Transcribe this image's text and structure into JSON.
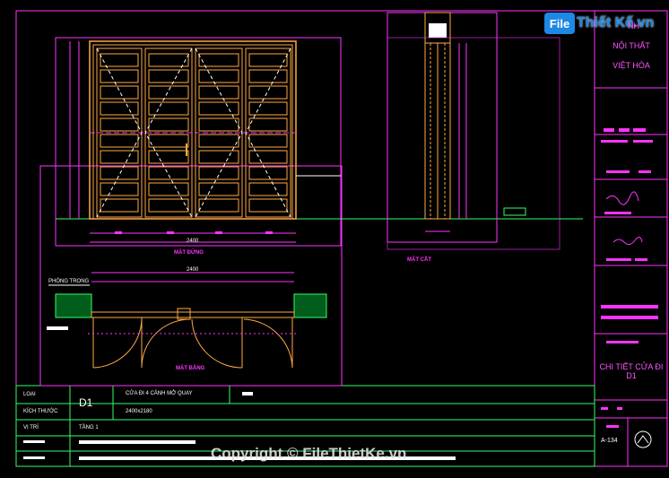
{
  "watermark": {
    "logo_prefix": "File",
    "logo_text": "Thiết Kế.vn",
    "copyright": "Copyright © FileThietKe.vn"
  },
  "title_block": {
    "company_line1": "NỘI THẤT",
    "company_line2": "VIỆT HÒA",
    "company_partial": "NH",
    "drawing_title": "CHI TIẾT CỬA ĐI D1",
    "sheet_number": "A-134"
  },
  "info_table": {
    "label_loai": "LOẠI",
    "label_kich_thuoc": "KÍCH THƯỚC",
    "label_vi_tri": "VỊ TRÍ",
    "code": "D1",
    "description": "CỬA ĐI 4 CÁNH MỞ QUAY",
    "size": "2400x2180",
    "floor": "TẦNG 1"
  },
  "views": {
    "elevation_title": "MẶT ĐỨNG",
    "section_title": "MẶT CẮT",
    "plan_title": "MẶT BẰNG",
    "room_label": "PHÒNG TRONG",
    "plan_dim": "2400",
    "elev_dim": "2400"
  },
  "colors": {
    "background": "#000000",
    "frame": "#ff33ff",
    "door": "#ffaa44",
    "green_line": "#33ff66",
    "white": "#ffffff"
  }
}
